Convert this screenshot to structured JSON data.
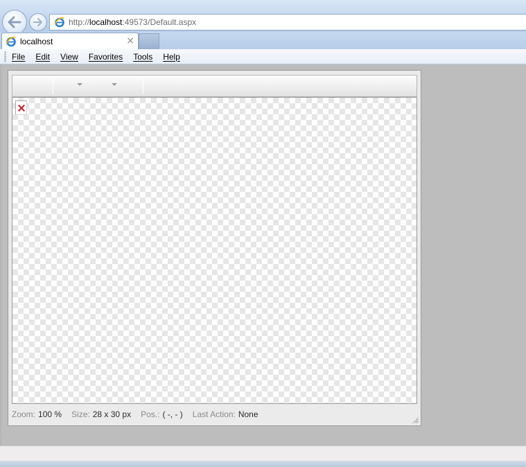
{
  "browser": {
    "address": {
      "prefix": "http://",
      "host": "localhost",
      "suffix": ":49573/Default.aspx"
    },
    "tab": {
      "title": "localhost",
      "close_glyph": "×"
    },
    "menu": [
      "File",
      "Edit",
      "View",
      "Favorites",
      "Tools",
      "Help"
    ],
    "icons": {
      "back": "back-arrow-icon",
      "forward": "forward-arrow-icon",
      "page": "ie-logo-icon",
      "broken_image": "broken-image-icon"
    }
  },
  "editor": {
    "status": {
      "zoom_label": "Zoom:",
      "zoom_value": "100 %",
      "size_label": "Size:",
      "size_value": "28 x 30 px",
      "pos_label": "Pos.:",
      "pos_value": "( -, - )",
      "action_label": "Last Action:",
      "action_value": "None"
    }
  },
  "colors": {
    "chrome": "#c3d8ef",
    "content_bg": "#bdbdbd",
    "editor_panel": "#ebebeb",
    "broken_image_x": "#c0282a"
  }
}
